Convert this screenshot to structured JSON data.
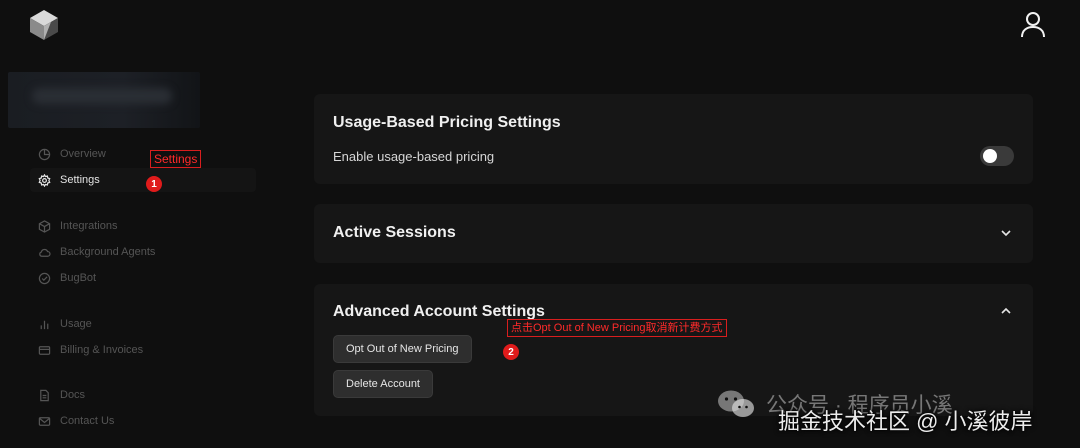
{
  "header": {
    "logo_icon": "cube-logo-icon",
    "profile_icon": "user-icon"
  },
  "sidebar": {
    "items": [
      {
        "label": "Overview",
        "icon": "pie-chart-icon",
        "active": false
      },
      {
        "label": "Settings",
        "icon": "gear-icon",
        "active": true
      },
      {
        "label": "Integrations",
        "icon": "cube-icon",
        "active": false
      },
      {
        "label": "Background Agents",
        "icon": "cloud-icon",
        "active": false
      },
      {
        "label": "BugBot",
        "icon": "check-circle-icon",
        "active": false
      },
      {
        "label": "Usage",
        "icon": "bar-chart-icon",
        "active": false
      },
      {
        "label": "Billing & Invoices",
        "icon": "credit-card-icon",
        "active": false
      },
      {
        "label": "Docs",
        "icon": "document-icon",
        "active": false
      },
      {
        "label": "Contact Us",
        "icon": "mail-icon",
        "active": false
      }
    ]
  },
  "main": {
    "usage_pricing": {
      "title": "Usage-Based Pricing Settings",
      "toggle_label": "Enable usage-based pricing",
      "toggle_on": false
    },
    "sessions": {
      "title": "Active Sessions",
      "icon": "chevron-down-icon"
    },
    "advanced": {
      "title": "Advanced Account Settings",
      "icon": "chevron-up-icon",
      "opt_out_label": "Opt Out of New Pricing",
      "delete_label": "Delete Account"
    }
  },
  "annotations": {
    "settings_label": "Settings",
    "step1": "1",
    "opt_out_hint": "点击Opt Out of New Pricing取消新计费方式",
    "step2": "2",
    "accent_color": "#e01b1b"
  },
  "watermark": {
    "line1": "公众号 · 程序员小溪",
    "line2": "掘金技术社区 @ 小溪彼岸"
  }
}
